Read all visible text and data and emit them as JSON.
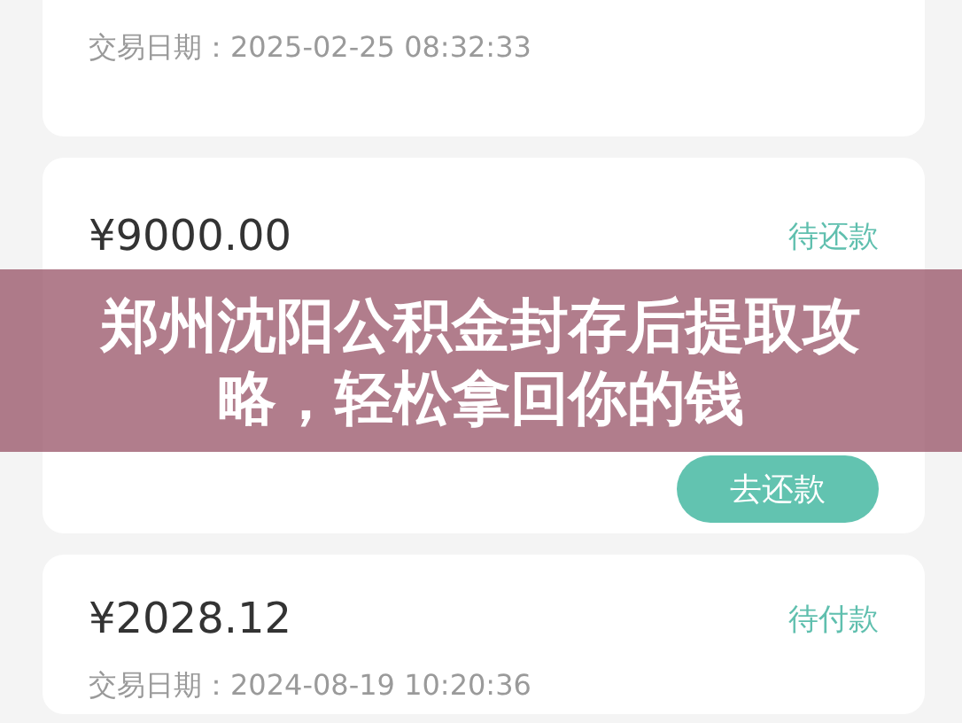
{
  "cards": [
    {
      "kind": "date-only",
      "date": "交易日期：2025-02-25 08:32:33"
    },
    {
      "kind": "payable",
      "amount": "¥9000.00",
      "status": "待还款",
      "button": "去还款"
    },
    {
      "kind": "amount-date",
      "amount": "¥2028.12",
      "status": "待付款",
      "date": "交易日期：2024-08-19 10:20:36"
    }
  ],
  "banner": {
    "title": "郑州沈阳公积金封存后提取攻略，轻松拿回你的钱"
  }
}
